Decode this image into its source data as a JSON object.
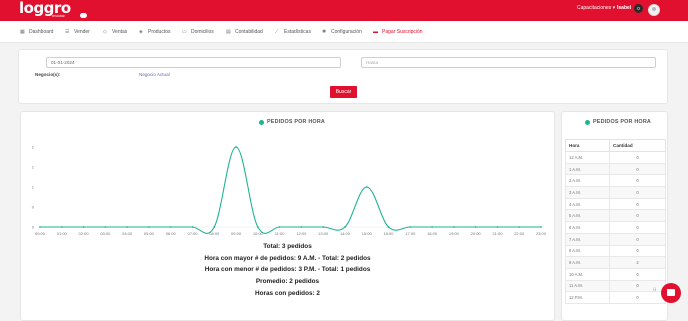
{
  "header": {
    "logo_text": "loggro",
    "logo_subtext": "restobar",
    "capacitaciones": "Capacitaciones ▾",
    "user_name": "Isabel",
    "notification_count": "0"
  },
  "nav": {
    "items": [
      {
        "label": "Dashboard",
        "icon": "dashboard-icon"
      },
      {
        "label": "Vender",
        "icon": "cart-icon"
      },
      {
        "label": "Ventas",
        "icon": "tag-icon"
      },
      {
        "label": "Productos",
        "icon": "box-icon"
      },
      {
        "label": "Domicilios",
        "icon": "truck-icon"
      },
      {
        "label": "Contabilidad",
        "icon": "document-icon"
      },
      {
        "label": "Estadísticas",
        "icon": "trend-icon"
      },
      {
        "label": "Configuración",
        "icon": "gear-icon"
      },
      {
        "label": "Pagar Suscripción",
        "icon": "credit-card-icon"
      }
    ],
    "active_color": "#e2102f"
  },
  "filters": {
    "date_value": "01-01-2024",
    "hasta_placeholder": "Hasta",
    "negocios_label": "Negocio(s):",
    "negocio_actual": "Negocio Actual",
    "search_button": "Buscar"
  },
  "chart_data": {
    "type": "line",
    "title": "PEDIDOS POR HORA",
    "color": "#1db492",
    "x": [
      "00:00",
      "01:00",
      "02:00",
      "03:00",
      "04:00",
      "05:00",
      "06:00",
      "07:00",
      "08:00",
      "09:00",
      "10:00",
      "11:00",
      "12:00",
      "13:00",
      "14:00",
      "15:00",
      "16:00",
      "17:00",
      "18:00",
      "19:00",
      "20:00",
      "21:00",
      "22:00",
      "23:00"
    ],
    "values": [
      0,
      0,
      0,
      0,
      0,
      0,
      0,
      0,
      0,
      2,
      0,
      0,
      0,
      0,
      0,
      1,
      0,
      0,
      0,
      0,
      0,
      0,
      0,
      0
    ],
    "yticks": [
      "2",
      "1",
      "1",
      "0",
      "0"
    ],
    "ylim": [
      0,
      2
    ],
    "grid": false
  },
  "summary": {
    "total": "Total: 3 pedidos",
    "mayor": "Hora con mayor # de pedidos: 9 A.M. - Total: 2 pedidos",
    "menor": "Hora con menor # de pedidos: 3 P.M. - Total: 1 pedidos",
    "promedio": "Promedio: 2 pedidos",
    "horas": "Horas con pedidos: 2"
  },
  "table": {
    "title": "PEDIDOS POR HORA",
    "headers": [
      "Hora",
      "Cantidad"
    ],
    "rows": [
      [
        "12 A.M.",
        "0"
      ],
      [
        "1 A.M.",
        "0"
      ],
      [
        "2 A.M.",
        "0"
      ],
      [
        "3 A.M.",
        "0"
      ],
      [
        "4 A.M.",
        "0"
      ],
      [
        "5 A.M.",
        "0"
      ],
      [
        "6 A.M.",
        "0"
      ],
      [
        "7 A.M.",
        "0"
      ],
      [
        "8 A.M.",
        "0"
      ],
      [
        "9 A.M.",
        "2"
      ],
      [
        "10 A.M.",
        "0"
      ],
      [
        "11 A.M.",
        "0"
      ],
      [
        "12 P.M.",
        "0"
      ]
    ]
  }
}
